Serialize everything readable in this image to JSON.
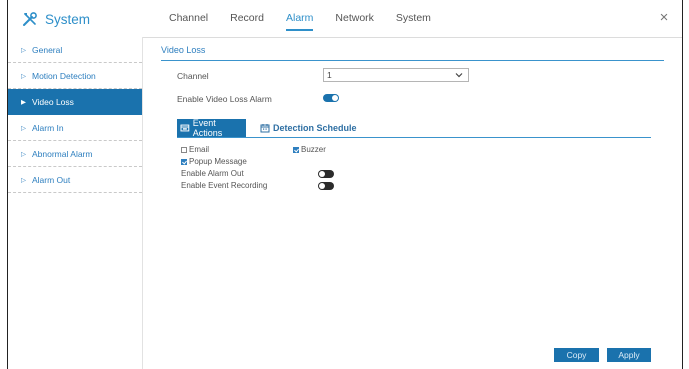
{
  "header": {
    "title": "System",
    "tabs": [
      "Channel",
      "Record",
      "Alarm",
      "Network",
      "System"
    ],
    "active_tab": "Alarm",
    "close_label": "×",
    "brand_icon": "tools-icon"
  },
  "sidebar": {
    "items": [
      {
        "label": "General",
        "active": false
      },
      {
        "label": "Motion Detection",
        "active": false
      },
      {
        "label": "Video Loss",
        "active": true
      },
      {
        "label": "Alarm In",
        "active": false
      },
      {
        "label": "Abnormal Alarm",
        "active": false
      },
      {
        "label": "Alarm Out",
        "active": false
      }
    ]
  },
  "main": {
    "section_title": "Video Loss",
    "channel_label": "Channel",
    "channel_value": "1",
    "enable_label": "Enable Video Loss Alarm",
    "enable_on": true,
    "subtabs": {
      "event_actions": "Event Actions",
      "detection_schedule": "Detection Schedule"
    },
    "options": {
      "email_label": "Email",
      "email_checked": false,
      "buzzer_label": "Buzzer",
      "buzzer_checked": true,
      "popup_label": "Popup Message",
      "popup_checked": true,
      "alarm_out_label": "Enable Alarm Out",
      "alarm_out_on": false,
      "event_rec_label": "Enable Event Recording",
      "event_rec_on": false
    },
    "buttons": {
      "copy": "Copy",
      "apply": "Apply"
    }
  },
  "colors": {
    "accent": "#2e8fc9",
    "active_bg": "#1a72ad",
    "link": "#2e7fbf"
  }
}
